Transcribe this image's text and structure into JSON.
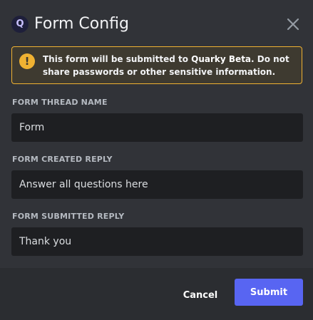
{
  "header": {
    "app_icon": "Q",
    "title": "Form Config",
    "close_icon": "close-icon"
  },
  "notice": {
    "icon": "!",
    "prefix": "This form will be submitted to ",
    "target": "Quarky Beta",
    "suffix": ". Do not share passwords or other sensitive information."
  },
  "fields": {
    "thread_name": {
      "label": "FORM THREAD NAME",
      "value": "Form"
    },
    "created_reply": {
      "label": "FORM CREATED REPLY",
      "value": "Answer all questions here"
    },
    "submitted_reply": {
      "label": "FORM SUBMITTED REPLY",
      "value": "Thank you"
    }
  },
  "footer": {
    "cancel_label": "Cancel",
    "submit_label": "Submit"
  },
  "colors": {
    "accent": "#5865f2",
    "warning": "#f0b232",
    "background": "#313338",
    "input_background": "#1e1f22"
  }
}
